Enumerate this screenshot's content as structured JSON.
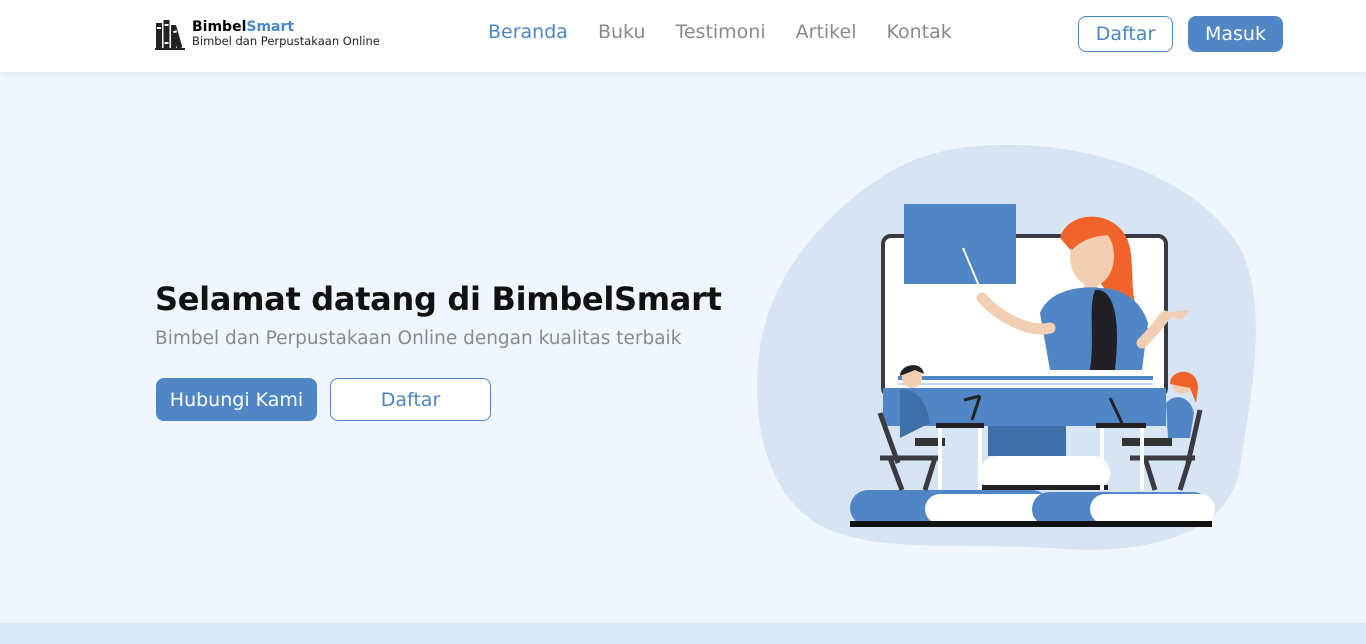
{
  "brand": {
    "name_part1": "Bimbel",
    "name_part2": "Smart",
    "tagline": "Bimbel dan Perpustakaan Online",
    "logo_icon": "bookshelf-icon"
  },
  "nav": {
    "items": [
      {
        "label": "Beranda",
        "active": true
      },
      {
        "label": "Buku",
        "active": false
      },
      {
        "label": "Testimoni",
        "active": false
      },
      {
        "label": "Artikel",
        "active": false
      },
      {
        "label": "Kontak",
        "active": false
      }
    ],
    "register_label": "Daftar",
    "login_label": "Masuk"
  },
  "hero": {
    "title": "Selamat datang di BimbelSmart",
    "subtitle": "Bimbel dan Perpustakaan Online dengan kualitas terbaik",
    "contact_button": "Hubungi Kami",
    "register_button": "Daftar",
    "illustration_icon": "online-teaching-illustration"
  },
  "colors": {
    "accent": "#4a86c8",
    "page_background": "#eff6fd",
    "blob": "#d7e4f4",
    "hair": "#f0642c"
  }
}
